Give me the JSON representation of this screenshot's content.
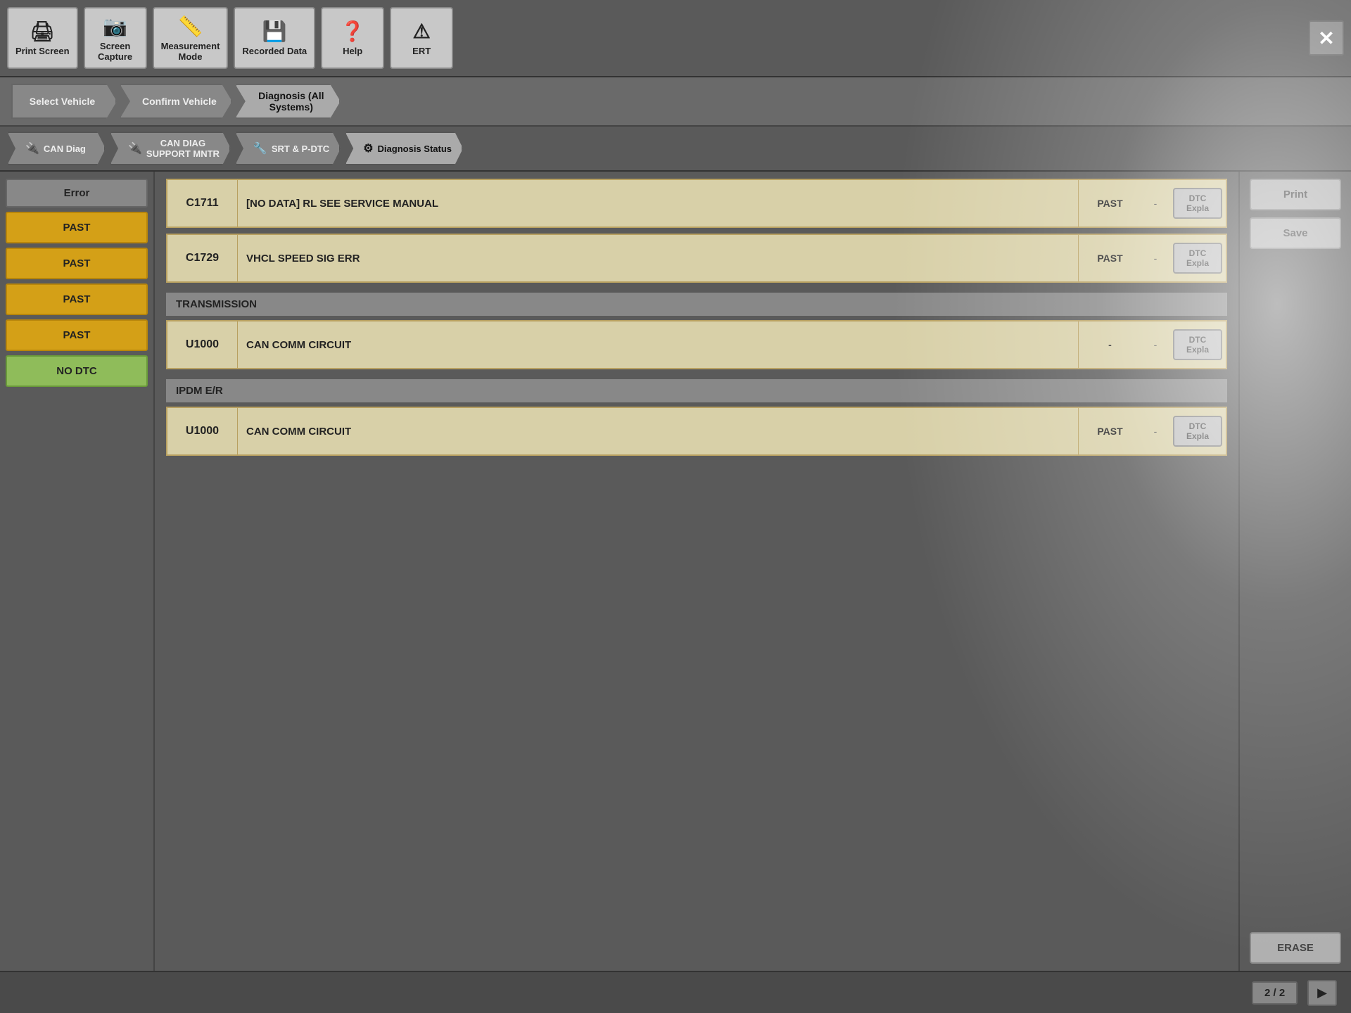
{
  "toolbar": {
    "buttons": [
      {
        "label": "Print Screen",
        "icon": "🖨"
      },
      {
        "label": "Screen\nCapture",
        "icon": "📷"
      },
      {
        "label": "Measurement\nMode",
        "icon": "📏"
      },
      {
        "label": "Recorded\nData",
        "icon": "💾"
      },
      {
        "label": "Help",
        "icon": "❓"
      },
      {
        "label": "ERT",
        "icon": "⚠"
      }
    ],
    "close_label": "✕"
  },
  "breadcrumb": {
    "items": [
      {
        "label": "Select Vehicle",
        "active": false
      },
      {
        "label": "Confirm Vehicle",
        "active": false
      },
      {
        "label": "Diagnosis (All\nSystems)",
        "active": true
      }
    ]
  },
  "tabs": [
    {
      "label": "CAN Diag",
      "icon": "🔌",
      "active": false
    },
    {
      "label": "CAN DIAG\nSUPPORT MNTR",
      "icon": "🔌",
      "active": false
    },
    {
      "label": "SRT & P-DTC",
      "icon": "🔧",
      "active": false
    },
    {
      "label": "Diagnosis Status",
      "icon": "⚙",
      "active": true
    }
  ],
  "sidebar": {
    "header": "Error",
    "items": [
      {
        "label": "PAST",
        "type": "yellow"
      },
      {
        "label": "PAST",
        "type": "yellow"
      },
      {
        "label": "PAST",
        "type": "yellow"
      },
      {
        "label": "PAST",
        "type": "yellow"
      },
      {
        "label": "NO DTC",
        "type": "green"
      }
    ]
  },
  "dtc_sections": [
    {
      "header": null,
      "rows": [
        {
          "code": "C1711",
          "description": "[NO DATA] RL SEE SERVICE MANUAL",
          "status": "PAST",
          "dash": "-",
          "expla_label": "DTC\nExpla"
        },
        {
          "code": "C1729",
          "description": "VHCL SPEED SIG ERR",
          "status": "PAST",
          "dash": "-",
          "expla_label": "DTC\nExpla"
        }
      ]
    },
    {
      "header": "TRANSMISSION",
      "rows": [
        {
          "code": "U1000",
          "description": "CAN COMM CIRCUIT",
          "status": "-",
          "dash": "-",
          "expla_label": "DTC\nExpla"
        }
      ]
    },
    {
      "header": "IPDM E/R",
      "rows": [
        {
          "code": "U1000",
          "description": "CAN COMM CIRCUIT",
          "status": "PAST",
          "dash": "-",
          "expla_label": "DTC\nExpla"
        }
      ]
    }
  ],
  "right_buttons": [
    {
      "label": "Print"
    },
    {
      "label": "Save"
    },
    {
      "label": "ERASE"
    }
  ],
  "status_bar": {
    "page": "2 / 2",
    "nav_icon": "▶"
  }
}
